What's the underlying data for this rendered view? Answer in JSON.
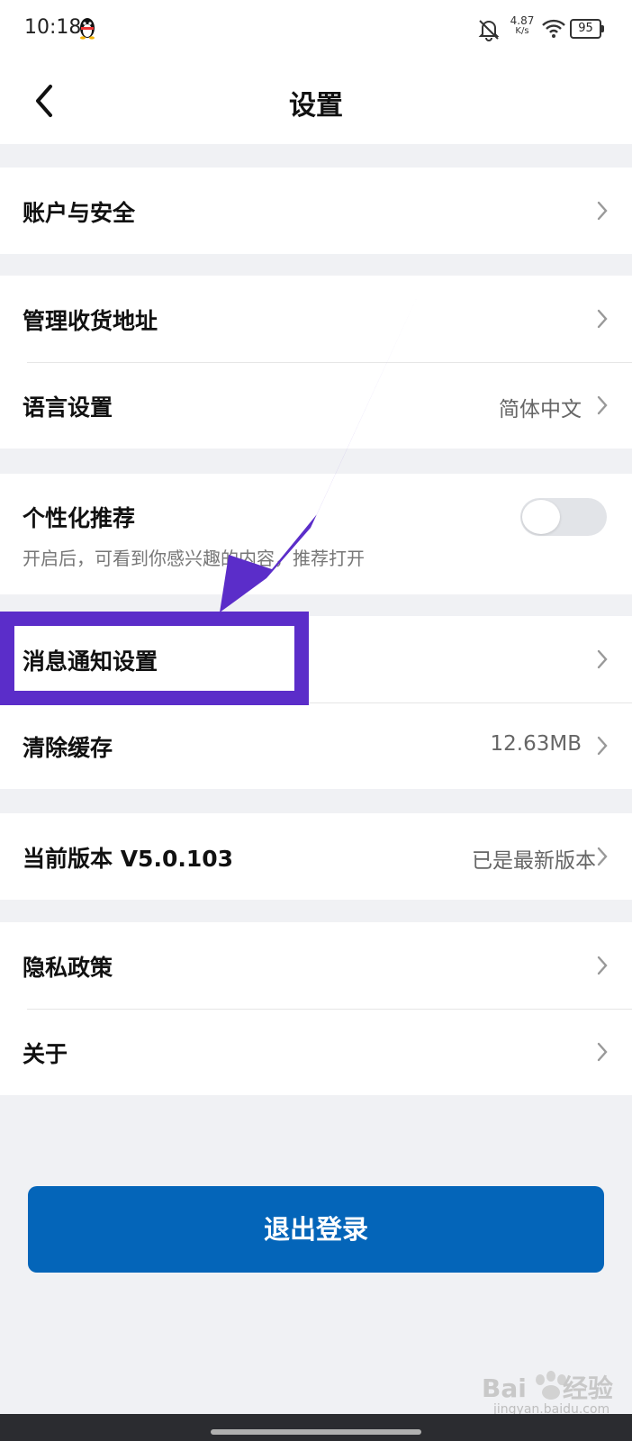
{
  "status_bar": {
    "time": "10:18",
    "net_speed_value": "4.87",
    "net_speed_unit": "K/s",
    "battery": "95",
    "icons": [
      "qq-icon",
      "bell-off-icon",
      "wifi-icon",
      "battery-icon"
    ]
  },
  "header": {
    "title": "设置",
    "back_icon": "chevron-left-icon"
  },
  "settings": {
    "account_security": "账户与安全",
    "manage_address": "管理收货地址",
    "language": {
      "label": "语言设置",
      "value": "简体中文"
    },
    "personalized": {
      "label": "个性化推荐",
      "description": "开启后，可看到你感兴趣的内容，推荐打开",
      "enabled": false
    },
    "notifications": "消息通知设置",
    "clear_cache": {
      "label": "清除缓存",
      "value": "12.63MB"
    },
    "version": {
      "label": "当前版本 V5.0.103",
      "value": "已是最新版本"
    },
    "privacy": "隐私政策",
    "about": "关于"
  },
  "logout_label": "退出登录",
  "watermark": {
    "brand": "Bai",
    "brand_suffix": "经验",
    "domain": "jingyan.baidu.com"
  },
  "colors": {
    "primary": "#0465b9",
    "annotation": "#5b2dc9",
    "page_bg": "#f0f1f4"
  }
}
